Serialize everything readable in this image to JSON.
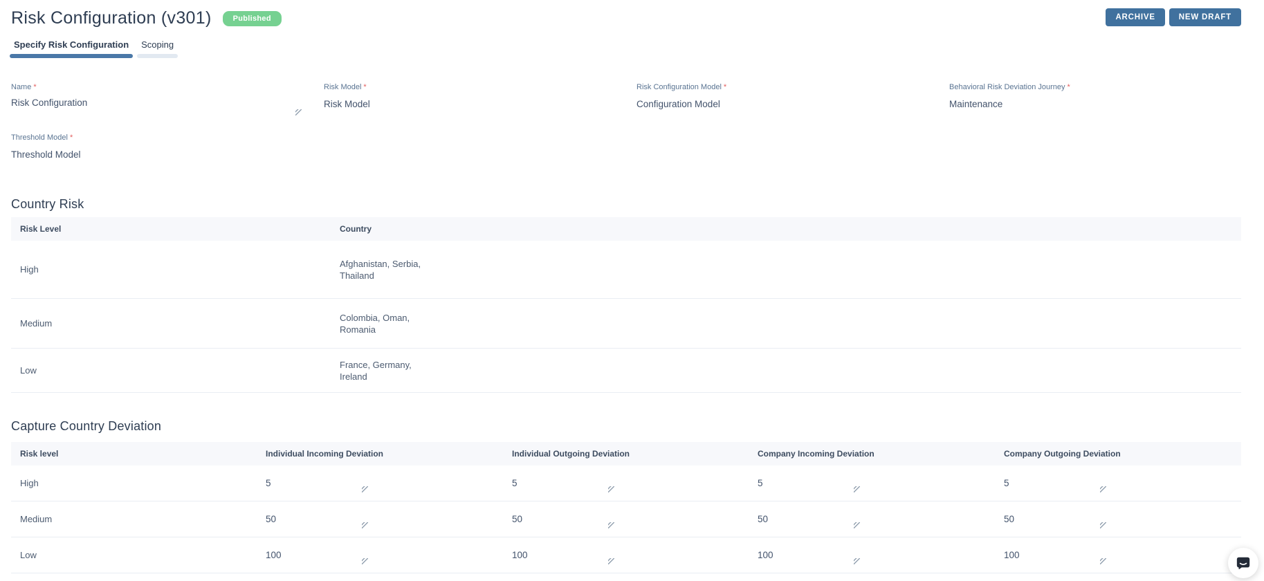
{
  "colors": {
    "accent_blue": "#40719e",
    "active_tab_bar": "#4a78a8",
    "badge_green": "#76d191",
    "table_header_bg": "#f7f8fb",
    "row_border": "#e9edf3",
    "required_red": "#e25d5d"
  },
  "icons": {
    "chat": "chat-bubble-icon",
    "resize": "resize-handle-icon"
  },
  "header": {
    "title": "Risk Configuration (v301)",
    "status_badge": "Published",
    "archive_button": "ARCHIVE",
    "new_draft_button": "NEW DRAFT"
  },
  "tabs": {
    "specify": "Specify Risk Configuration",
    "scoping": "Scoping"
  },
  "form": {
    "required_marker": "*",
    "name": {
      "label": "Name",
      "value": "Risk Configuration"
    },
    "risk_model": {
      "label": "Risk Model",
      "value": "Risk Model"
    },
    "risk_configuration_model": {
      "label": "Risk Configuration Model",
      "value": "Configuration Model"
    },
    "behavioral_risk_deviation_journey": {
      "label": "Behavioral Risk Deviation Journey",
      "value": "Maintenance"
    },
    "threshold_model": {
      "label": "Threshold Model",
      "value": "Threshold Model"
    }
  },
  "country_risk": {
    "heading": "Country Risk",
    "columns": [
      "Risk Level",
      "Country"
    ],
    "rows": [
      {
        "risk_level": "High",
        "countries": "Afghanistan, Serbia, Thailand"
      },
      {
        "risk_level": "Medium",
        "countries": "Colombia, Oman, Romania"
      },
      {
        "risk_level": "Low",
        "countries": "France, Germany, Ireland"
      }
    ]
  },
  "capture_country_deviation": {
    "heading": "Capture Country Deviation",
    "columns": [
      "Risk level",
      "Individual Incoming Deviation",
      "Individual Outgoing Deviation",
      "Company Incoming Deviation",
      "Company Outgoing Deviation"
    ],
    "rows": [
      {
        "risk_level": "High",
        "values": [
          "5",
          "5",
          "5",
          "5"
        ]
      },
      {
        "risk_level": "Medium",
        "values": [
          "50",
          "50",
          "50",
          "50"
        ]
      },
      {
        "risk_level": "Low",
        "values": [
          "100",
          "100",
          "100",
          "100"
        ]
      }
    ]
  }
}
